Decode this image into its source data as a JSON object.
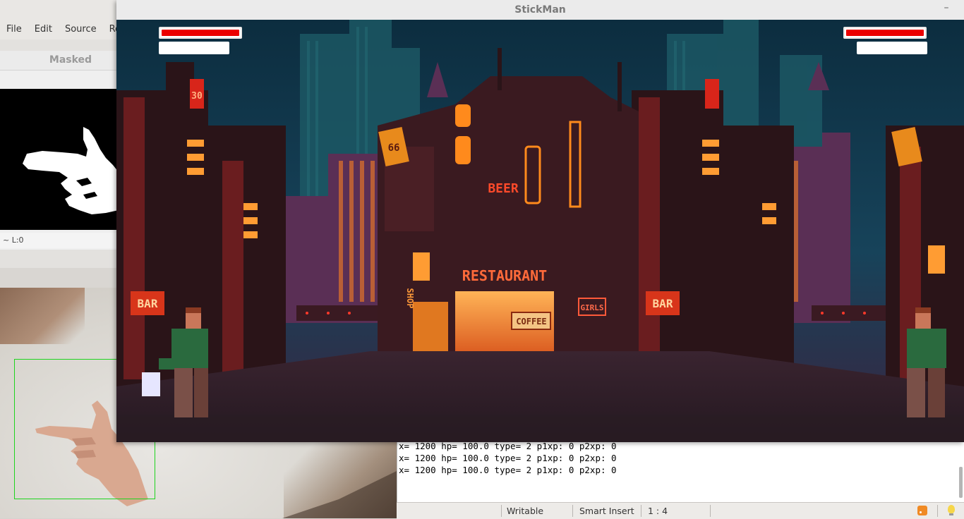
{
  "ide": {
    "menu": [
      "File",
      "Edit",
      "Source",
      "Refac"
    ],
    "masked_title": "Masked",
    "masked_status": "~ L:0"
  },
  "game": {
    "title": "StickMan",
    "minimize": "–",
    "player1": {
      "hp_fraction": 1.0
    },
    "player2": {
      "hp_fraction": 1.0
    },
    "signs": {
      "bar_left": "BAR",
      "bar_right": "BAR",
      "beer": "BEER",
      "restaurant": "RESTAURANT",
      "coffee": "COFFEE",
      "girls": "GIRLS",
      "shop": "SHOP",
      "num_30": "30",
      "num_66": "66"
    }
  },
  "console": {
    "lines": [
      "x= 1200 hp= 100.0 type= 2 p1xp: 0 p2xp: 0",
      "x= 1200 hp= 100.0 type= 2 p1xp: 0 p2xp: 0",
      "x= 1200 hp= 100.0 type= 2 p1xp: 0 p2xp: 0"
    ]
  },
  "statusbar": {
    "mode": "Writable",
    "insert": "Smart Insert",
    "position": "1 : 4"
  },
  "colors": {
    "hp_red": "#ec0000",
    "roi_green": "#1ed41e",
    "sky": "#0f3a4a",
    "neon_orange": "#ff8a1c"
  },
  "icons": [
    "rss-icon",
    "bulb-icon",
    "minimize-icon"
  ]
}
